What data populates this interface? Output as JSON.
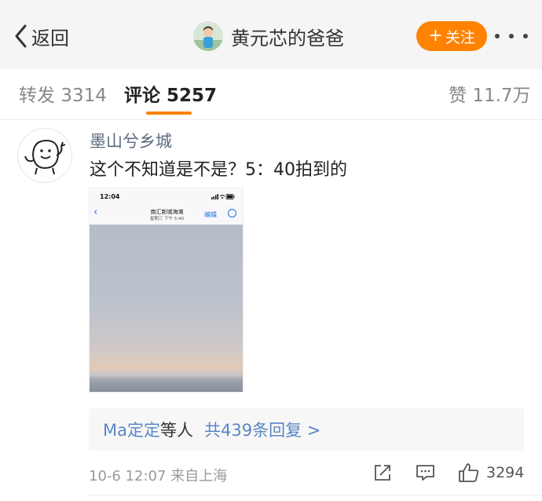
{
  "header": {
    "back_label": "返回",
    "author_name": "黄元芯的爸爸",
    "follow_label": "关注",
    "follow_color": "#ff8200"
  },
  "tabs": [
    {
      "label": "转发",
      "count": "3314"
    },
    {
      "label": "评论",
      "count": "5257",
      "active": true
    },
    {
      "label": "赞",
      "count": "11.7万"
    }
  ],
  "comment": {
    "username": "墨山兮乡城",
    "text": "这个不知道是不是？5：40拍到的",
    "photo": {
      "status_time": "12:04",
      "nav_title": "南汇新城海滩",
      "nav_subtitle": "星期三  下午 5:40",
      "nav_edit": "编辑"
    },
    "replies": {
      "name": "Ma定定",
      "others": "等人",
      "count_text": "共439条回复 >"
    },
    "timestamp": "10-6 12:07",
    "source": "来自上海",
    "likes": "3294"
  },
  "icons": {
    "back": "chevron-left-icon",
    "more": "more-dots-icon",
    "share": "share-icon",
    "reply": "comment-icon",
    "like": "thumbs-up-icon"
  },
  "colors": {
    "accent": "#ff8200",
    "link": "#5b86c5"
  }
}
